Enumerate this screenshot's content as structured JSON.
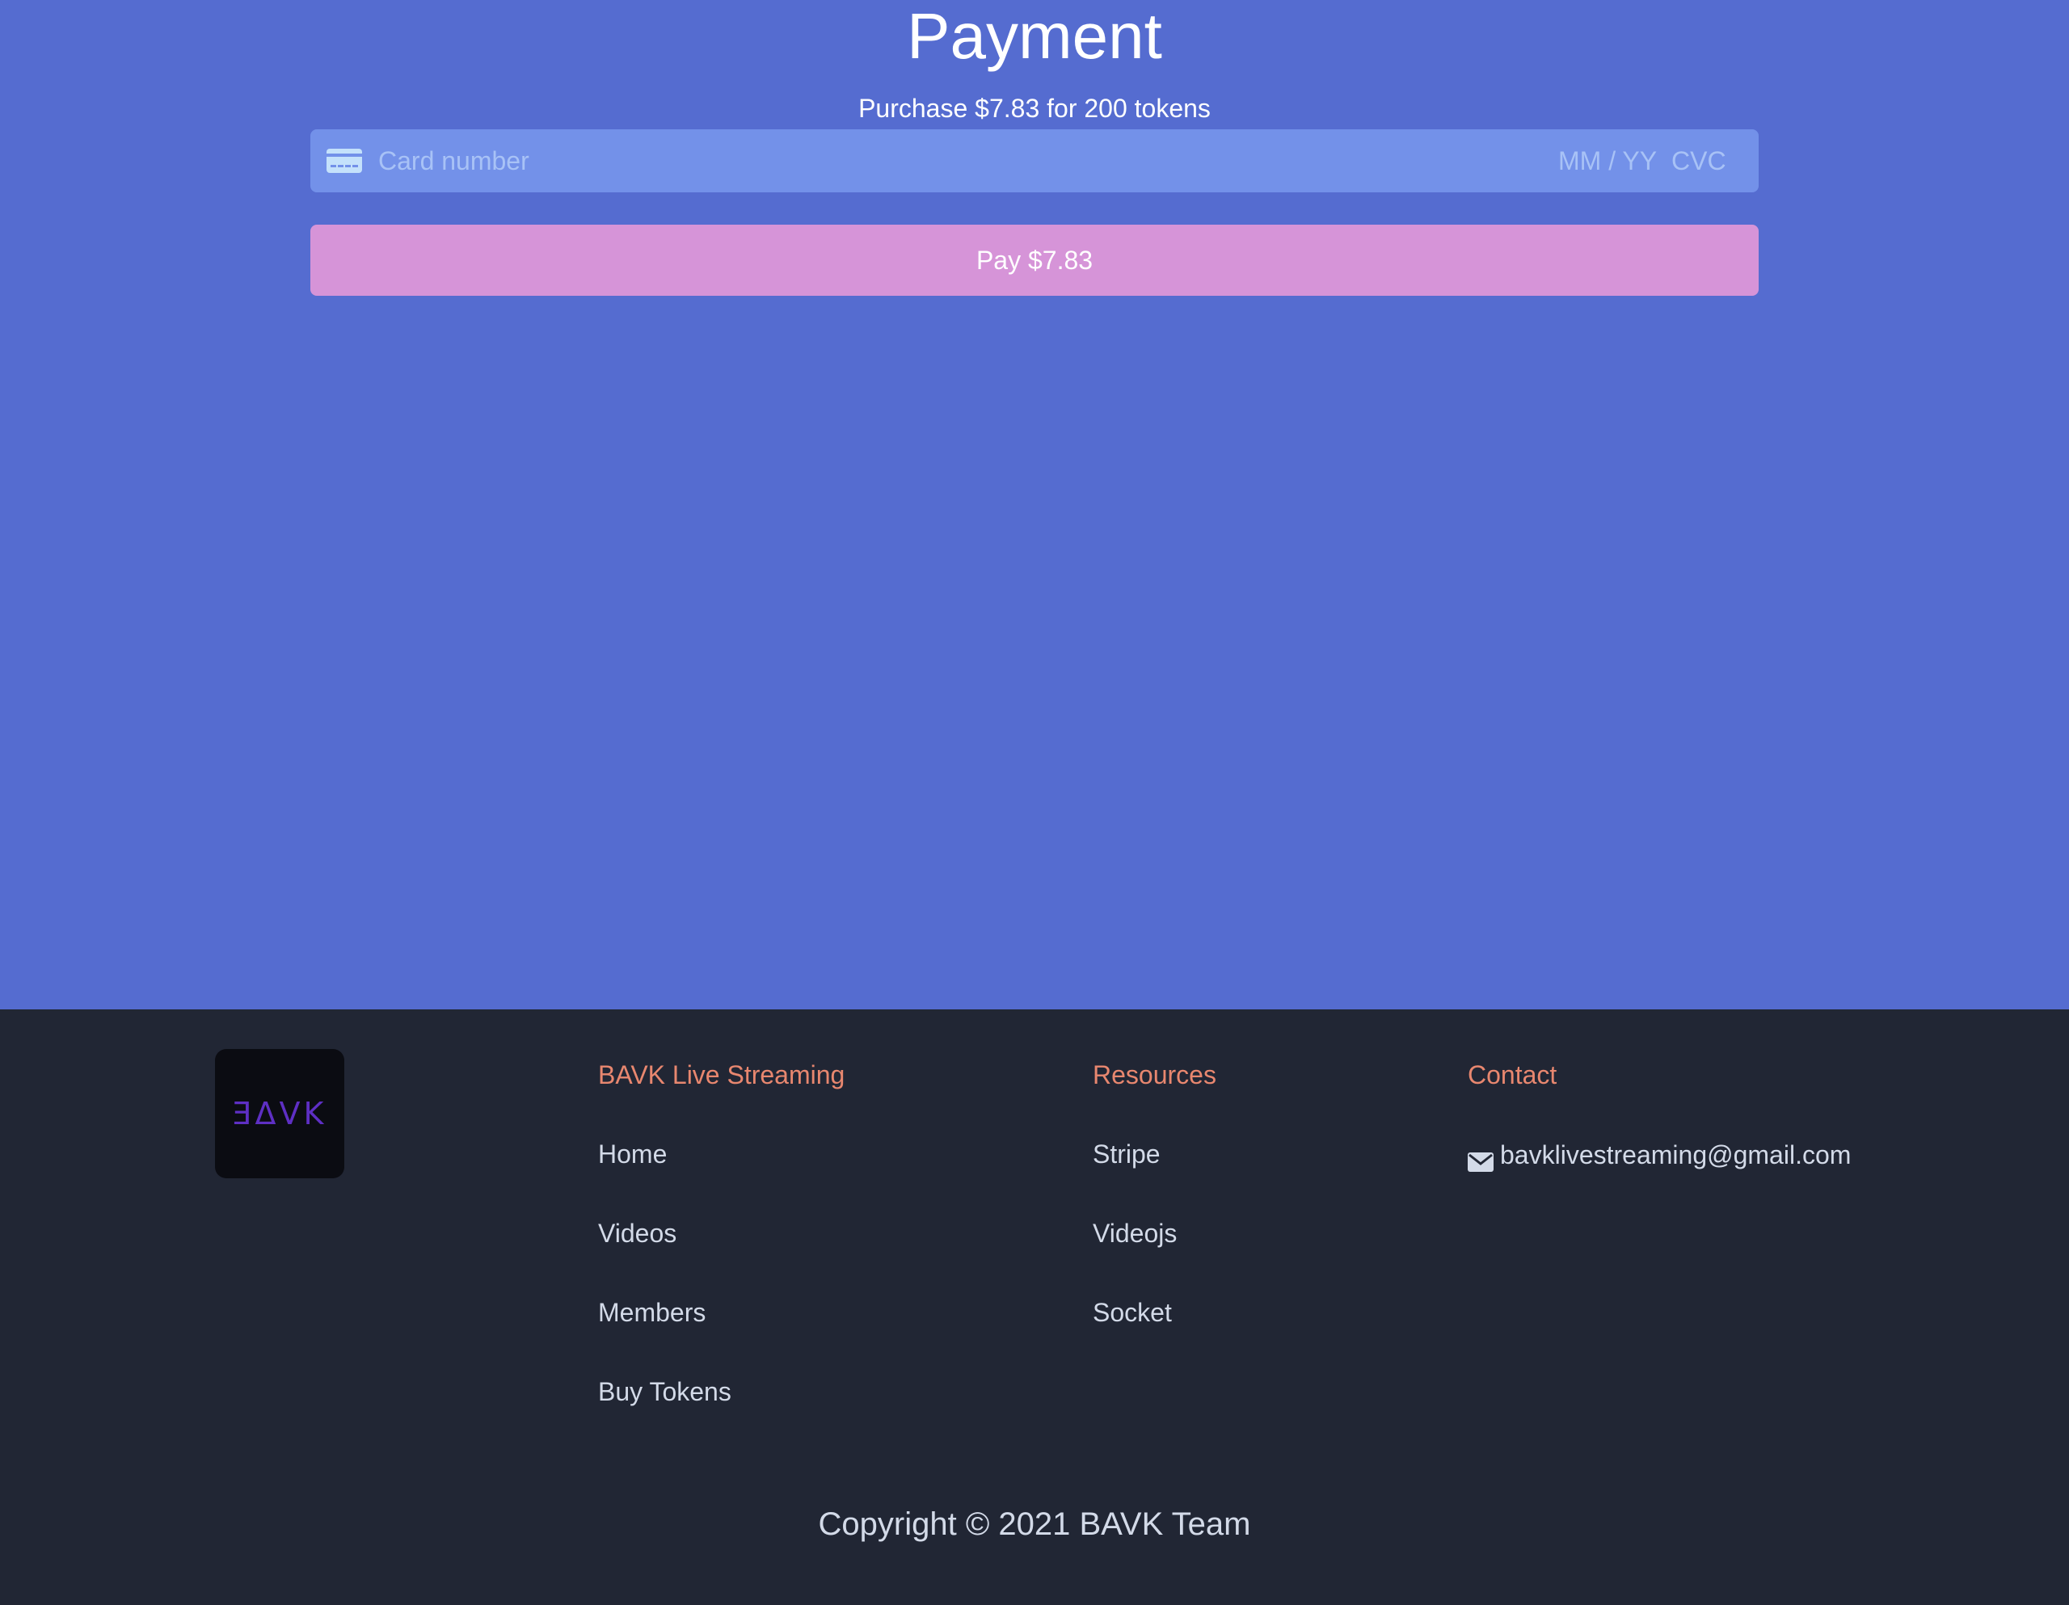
{
  "payment": {
    "title": "Payment",
    "subtitle": "Purchase $7.83 for 200 tokens",
    "card_number_placeholder": "Card number",
    "expiry_placeholder": "MM / YY",
    "cvc_placeholder": "CVC",
    "pay_button_label": "Pay $7.83",
    "card_icon": "credit-card-icon"
  },
  "footer": {
    "logo_text": "BAVK",
    "columns": [
      {
        "heading": "BAVK Live Streaming",
        "links": [
          "Home",
          "Videos",
          "Members",
          "Buy Tokens"
        ]
      },
      {
        "heading": "Resources",
        "links": [
          "Stripe",
          "Videojs",
          "Socket"
        ]
      },
      {
        "heading": "Contact",
        "email": "bavklivestreaming@gmail.com",
        "email_icon": "envelope-icon"
      }
    ],
    "copyright": "Copyright © 2021 BAVK Team"
  },
  "colors": {
    "page_background": "#556cd0",
    "card_field_background": "#7391e9",
    "pay_button_background": "#d694d8",
    "footer_background": "#212634",
    "footer_heading": "#e8876f",
    "footer_link": "#d3dae8",
    "logo_text": "#5e2fc4"
  }
}
